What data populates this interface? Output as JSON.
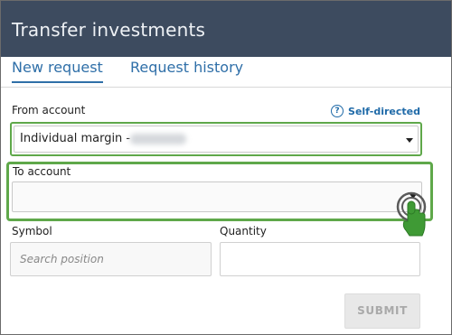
{
  "header": {
    "title": "Transfer investments"
  },
  "tabs": [
    {
      "label": "New request",
      "active": true
    },
    {
      "label": "Request history",
      "active": false
    }
  ],
  "from_account": {
    "label": "From account",
    "help_link": "Self-directed",
    "help_icon": "question-circle-icon",
    "value": "Individual margin -"
  },
  "to_account": {
    "label": "To account",
    "value": ""
  },
  "symbol": {
    "label": "Symbol",
    "placeholder": "Search position"
  },
  "quantity": {
    "label": "Quantity",
    "value": ""
  },
  "submit": {
    "label": "SUBMIT"
  },
  "colors": {
    "header_bg": "#3d4b5f",
    "accent": "#2f6fa8",
    "highlight": "#5fa84a",
    "disabled_text": "#a9a9a9"
  },
  "icons": {
    "dropdown": "caret-down-icon",
    "pointer": "hand-pointer-icon"
  }
}
